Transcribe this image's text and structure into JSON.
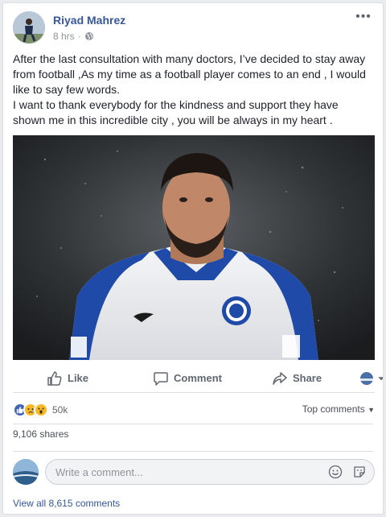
{
  "post": {
    "author": "Riyad Mahrez",
    "time": "8 hrs",
    "privacy_icon": "globe-icon",
    "more_icon": "more-icon",
    "paragraphs": [
      "After the last consultation with many doctors, I’ve decided to stay away from football ,As my time as a football player comes to an end , I would like to say few words.",
      "I want to thank everybody for the kindness and support they have shown me in this incredible city , you will be always in my heart ."
    ]
  },
  "actions": {
    "like": "Like",
    "comment": "Comment",
    "share": "Share"
  },
  "reactions": {
    "icons": [
      "like-reaction-icon",
      "sad-reaction-icon",
      "wow-reaction-icon"
    ],
    "count": "50k",
    "top_comments": "Top comments"
  },
  "shares": "9,106 shares",
  "comment_box": {
    "placeholder": "Write a comment..."
  },
  "view_all": "View all 8,615 comments",
  "colors": {
    "link": "#365899",
    "like_blue": "#4267b2",
    "reaction_yellow": "#f7b928"
  }
}
